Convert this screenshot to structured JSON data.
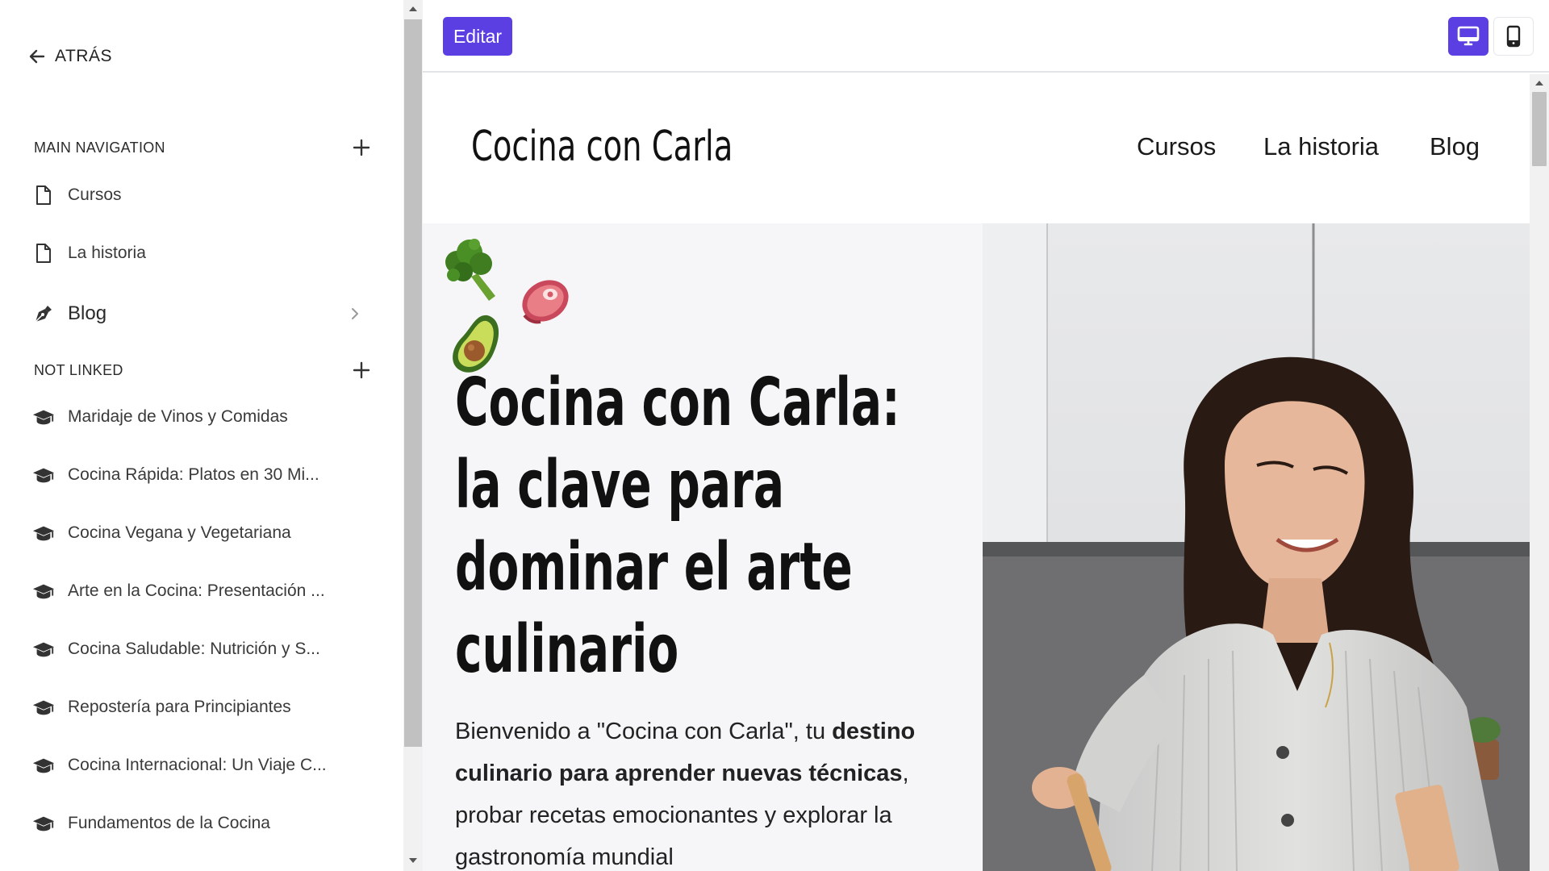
{
  "sidebar": {
    "back_label": "ATRÁS",
    "main_nav": {
      "title": "MAIN NAVIGATION",
      "items": [
        {
          "label": "Cursos",
          "icon": "page-icon"
        },
        {
          "label": "La historia",
          "icon": "page-icon"
        },
        {
          "label": "Blog",
          "icon": "pen-nib-icon"
        }
      ]
    },
    "not_linked": {
      "title": "NOT LINKED",
      "items": [
        {
          "label": "Maridaje de Vinos y Comidas",
          "icon": "graduation-cap-icon"
        },
        {
          "label": "Cocina Rápida: Platos en 30 Mi...",
          "icon": "graduation-cap-icon"
        },
        {
          "label": "Cocina Vegana y Vegetariana",
          "icon": "graduation-cap-icon"
        },
        {
          "label": "Arte en la Cocina: Presentación ...",
          "icon": "graduation-cap-icon"
        },
        {
          "label": "Cocina Saludable: Nutrición y S...",
          "icon": "graduation-cap-icon"
        },
        {
          "label": "Repostería para Principiantes",
          "icon": "graduation-cap-icon"
        },
        {
          "label": "Cocina Internacional: Un Viaje C...",
          "icon": "graduation-cap-icon"
        },
        {
          "label": "Fundamentos de la Cocina",
          "icon": "graduation-cap-icon"
        }
      ]
    }
  },
  "toolbar": {
    "edit_label": "Editar",
    "view_modes": [
      "desktop-icon",
      "mobile-icon"
    ],
    "active_view": "desktop",
    "accent_color": "#5b3fe3"
  },
  "site": {
    "logo": "Cocina con Carla",
    "nav": [
      "Cursos",
      "La historia",
      "Blog"
    ],
    "hero": {
      "title_lines": [
        "Cocina con Carla:",
        "la clave para",
        "dominar el arte",
        "culinario"
      ],
      "text_part1": "Bienvenido a \"Cocina con Carla\", tu ",
      "text_bold": "destino culinario para aprender nuevas técnicas",
      "text_part2": ", probar recetas emocionantes y explorar la gastronomía mundial",
      "decor": [
        "broccoli-icon",
        "steak-icon",
        "avocado-icon"
      ]
    }
  }
}
